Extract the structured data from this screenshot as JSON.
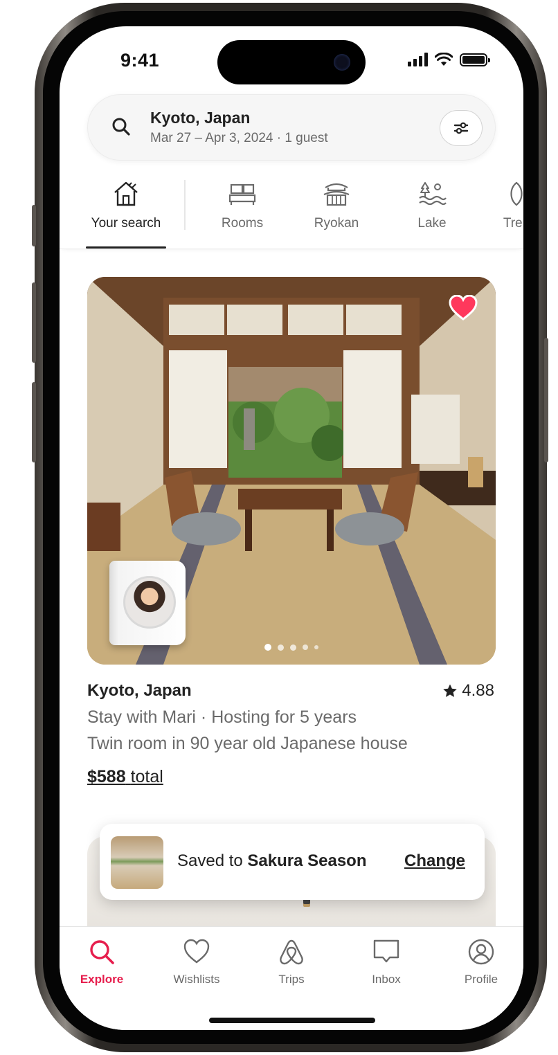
{
  "status_bar": {
    "time": "9:41"
  },
  "search": {
    "title": "Kyoto, Japan",
    "subtitle": "Mar 27 – Apr 3, 2024 · 1 guest"
  },
  "categories": [
    {
      "label": "Your search",
      "icon": "house-icon",
      "active": true
    },
    {
      "label": "Rooms",
      "icon": "bed-icon"
    },
    {
      "label": "Ryokan",
      "icon": "pagoda-icon"
    },
    {
      "label": "Lake",
      "icon": "lake-icon"
    },
    {
      "label": "Tren",
      "icon": "trending-icon"
    }
  ],
  "listing": {
    "title": "Kyoto, Japan",
    "rating": "4.88",
    "host_line": "Stay with Mari · Hosting for 5 years",
    "description": "Twin room in 90 year old Japanese house",
    "price_amount": "$588",
    "price_suffix": "total",
    "saved": true,
    "photo_count": 5,
    "photo_index": 1
  },
  "toast": {
    "prefix": "Saved to",
    "collection": "Sakura Season",
    "action": "Change"
  },
  "tab_bar": [
    {
      "label": "Explore",
      "icon": "search-icon",
      "active": true
    },
    {
      "label": "Wishlists",
      "icon": "heart-icon"
    },
    {
      "label": "Trips",
      "icon": "airbnb-logo-icon"
    },
    {
      "label": "Inbox",
      "icon": "message-icon"
    },
    {
      "label": "Profile",
      "icon": "profile-icon"
    }
  ],
  "colors": {
    "brand": "#e61e4d",
    "text_primary": "#222222",
    "text_secondary": "#6a6a6a"
  }
}
